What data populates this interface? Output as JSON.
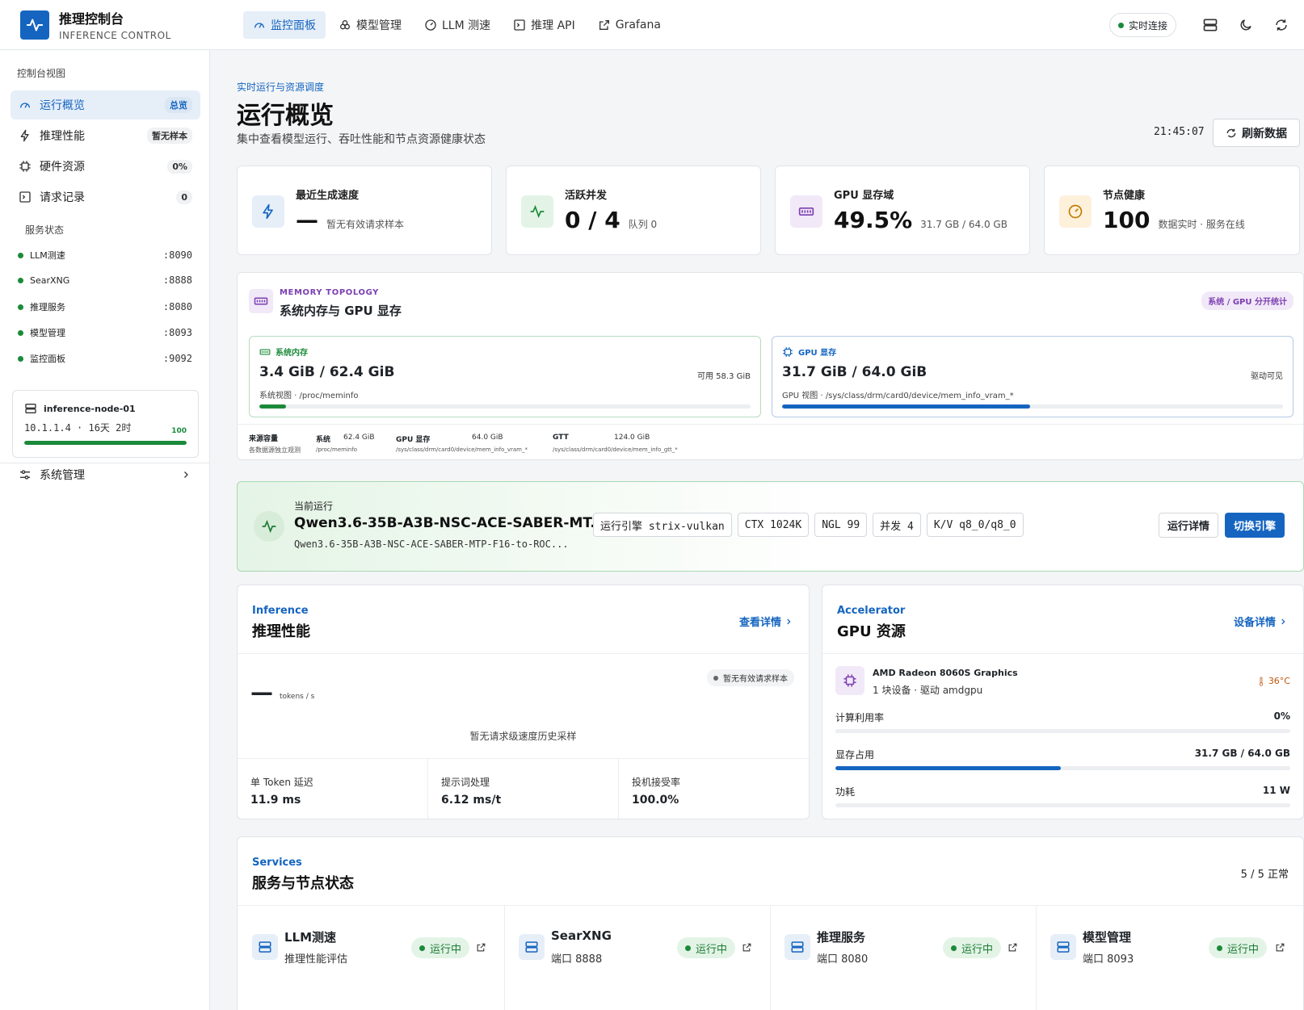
{
  "header": {
    "brand_title": "推理控制台",
    "brand_sub": "INFERENCE CONTROL",
    "nav": [
      {
        "label": "监控面板",
        "icon": "gauge-icon",
        "active": true
      },
      {
        "label": "模型管理",
        "icon": "cubes-icon"
      },
      {
        "label": "LLM 测速",
        "icon": "speedometer-icon"
      },
      {
        "label": "推理 API",
        "icon": "terminal-icon"
      },
      {
        "label": "Grafana",
        "icon": "external-link-icon"
      }
    ],
    "live_label": "实时连接"
  },
  "sidebar": {
    "section_title": "控制台视图",
    "items": [
      {
        "label": "运行概览",
        "badge": "总览",
        "icon": "gauge-icon"
      },
      {
        "label": "推理性能",
        "badge": "暂无样本",
        "icon": "bolt-icon"
      },
      {
        "label": "硬件资源",
        "badge": "0%",
        "icon": "chip-icon"
      },
      {
        "label": "请求记录",
        "badge": "0",
        "icon": "terminal-icon"
      }
    ],
    "services_title": "服务状态",
    "services": [
      {
        "name": "LLM测速",
        "port": ":8090"
      },
      {
        "name": "SearXNG",
        "port": ":8888"
      },
      {
        "name": "推理服务",
        "port": ":8080"
      },
      {
        "name": "模型管理",
        "port": ":8093"
      },
      {
        "name": "监控面板",
        "port": ":9092"
      }
    ],
    "node": {
      "name": "inference-node-01",
      "info": "10.1.1.4 · 16天 2时",
      "score": "100",
      "health": 1.0
    },
    "admin_label": "系统管理"
  },
  "page": {
    "eyebrow": "实时运行与资源调度",
    "title": "运行概览",
    "subtitle": "集中查看模型运行、吞吐性能和节点资源健康状态",
    "time": "21:45:07",
    "refresh_label": "刷新数据"
  },
  "kpis": [
    {
      "label": "最近生成速度",
      "value": "—",
      "sub": "暂无有效请求样本",
      "icon": "bolt-icon",
      "color": "#1565c0",
      "bg": "#e6eef8"
    },
    {
      "label": "活跃并发",
      "value": "0 / 4",
      "sub": "队列 0",
      "icon": "pulse-icon",
      "color": "#1b8a3a",
      "bg": "#e3f4e6"
    },
    {
      "label": "GPU 显存域",
      "value": "49.5%",
      "sub": "31.7 GB / 64.0 GB",
      "icon": "memory-icon",
      "color": "#7b3fb0",
      "bg": "#f1e8f8"
    },
    {
      "label": "节点健康",
      "value": "100",
      "sub": "数据实时 · 服务在线",
      "icon": "speedometer-icon",
      "color": "#c27a00",
      "bg": "#fdf1dc"
    }
  ],
  "memory": {
    "eyebrow": "MEMORY TOPOLOGY",
    "title": "系统内存与 GPU 显存",
    "badge": "系统 / GPU 分开统计",
    "system": {
      "label": "系统内存",
      "value": "3.4 GiB / 62.4 GiB",
      "right": "可用 58.3 GiB",
      "path": "系统视图 · /proc/meminfo",
      "usage": 0.055
    },
    "gpu": {
      "label": "GPU 显存",
      "value": "31.7 GiB / 64.0 GiB",
      "right": "驱动可见",
      "path": "GPU 视图 · /sys/class/drm/card0/device/mem_info_vram_*",
      "usage": 0.495
    },
    "footer": {
      "title": "来源容量",
      "sub": "各数据源独立观测",
      "cols": [
        {
          "name": "系统",
          "val": "62.4 GiB",
          "path": "/proc/meminfo"
        },
        {
          "name": "GPU 显存",
          "val": "64.0 GiB",
          "path": "/sys/class/drm/card0/device/mem_info_vram_*"
        },
        {
          "name": "GTT",
          "val": "124.0 GiB",
          "path": "/sys/class/drm/card0/device/mem_info_gtt_*"
        }
      ]
    }
  },
  "running": {
    "label": "当前运行",
    "model": "Qwen3.6-35B-A3B-NSC-ACE-SABER-MT...",
    "model_full": "Qwen3.6-35B-A3B-NSC-ACE-SABER-MTP-F16-to-ROC...",
    "chips": [
      "运行引擎 strix-vulkan",
      "CTX 1024K",
      "NGL 99",
      "并发 4",
      "K/V q8_0/q8_0"
    ],
    "details_label": "运行详情",
    "switch_label": "切换引擎"
  },
  "inference": {
    "eyebrow": "Inference",
    "title": "推理性能",
    "link": "查看详情",
    "value": "—",
    "unit": "tokens / s",
    "status": "暂无有效请求样本",
    "empty": "暂无请求级速度历史采样",
    "metrics": [
      {
        "label": "单 Token 延迟",
        "value": "11.9 ms"
      },
      {
        "label": "提示词处理",
        "value": "6.12 ms/t"
      },
      {
        "label": "投机接受率",
        "value": "100.0%"
      }
    ]
  },
  "gpu": {
    "eyebrow": "Accelerator",
    "title": "GPU 资源",
    "link": "设备详情",
    "device": "AMD Radeon 8060S Graphics",
    "device_sub": "1 块设备 · 驱动 amdgpu",
    "temp": "36°C",
    "rows": [
      {
        "label": "计算利用率",
        "value": "0%",
        "usage": 0.0
      },
      {
        "label": "显存占用",
        "value": "31.7 GB / 64.0 GB",
        "usage": 0.495
      },
      {
        "label": "功耗",
        "value": "11 W",
        "usage": 0.0
      }
    ]
  },
  "services": {
    "eyebrow": "Services",
    "title": "服务与节点状态",
    "summary": "5 / 5 正常",
    "items": [
      {
        "name": "LLM测速",
        "sub": "推理性能评估",
        "status": "运行中"
      },
      {
        "name": "SearXNG",
        "sub": "端口 8888",
        "status": "运行中"
      },
      {
        "name": "推理服务",
        "sub": "端口 8080",
        "status": "运行中"
      },
      {
        "name": "模型管理",
        "sub": "端口 8093",
        "status": "运行中"
      }
    ]
  },
  "colors": {
    "accent": "#1565c0",
    "ok": "#1b8a3a",
    "purple": "#7b3fb0"
  }
}
